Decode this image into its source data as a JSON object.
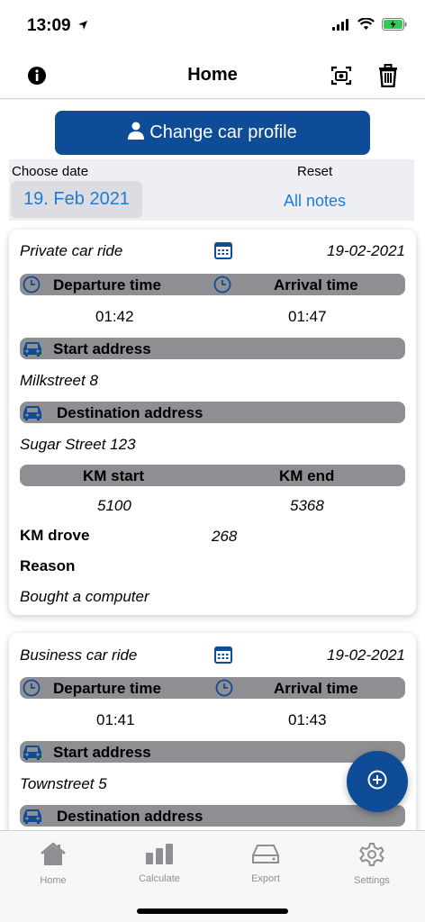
{
  "status": {
    "time": "13:09"
  },
  "header": {
    "title": "Home"
  },
  "profile": {
    "label": "Change car profile"
  },
  "date_filter": {
    "choose_label": "Choose date",
    "date_value": "19. Feb 2021",
    "reset_label": "Reset",
    "all_notes_label": "All notes"
  },
  "labels": {
    "departure": "Departure time",
    "arrival": "Arrival time",
    "start_address": "Start address",
    "destination_address": "Destination address",
    "km_start": "KM start",
    "km_end": "KM end",
    "km_drove": "KM drove",
    "reason": "Reason"
  },
  "rides": [
    {
      "type": "Private car ride",
      "date": "19-02-2021",
      "departure": "01:42",
      "arrival": "01:47",
      "start_address": "Milkstreet 8",
      "destination": "Sugar Street 123",
      "km_start": "5100",
      "km_end": "5368",
      "km_drove": "268",
      "reason": "Bought a computer"
    },
    {
      "type": "Business car ride",
      "date": "19-02-2021",
      "departure": "01:41",
      "arrival": "01:43",
      "start_address": "Townstreet 5"
    }
  ],
  "tabs": [
    {
      "label": "Home",
      "icon": "home-icon"
    },
    {
      "label": "Calculate",
      "icon": "bar-chart-icon"
    },
    {
      "label": "Export",
      "icon": "drive-icon"
    },
    {
      "label": "Settings",
      "icon": "gear-icon"
    }
  ],
  "colors": {
    "brand": "#0f4c97",
    "link": "#1e7cd6",
    "bar": "#8e8e93"
  }
}
